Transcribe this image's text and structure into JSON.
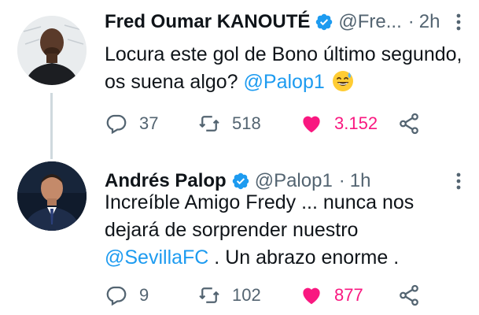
{
  "tweets": [
    {
      "author_name": "Fred Oumar KANOUTÉ",
      "handle": "@Fre...",
      "separator": "·",
      "time": "2h",
      "text_before": "Locura este gol de Bono último segundo, os suena algo? ",
      "mention": "@Palop1",
      "emoji": "grinning-sweat-emoji",
      "replies": "37",
      "retweets": "518",
      "likes": "3.152",
      "liked": true
    },
    {
      "author_name": "Andrés Palop",
      "handle": "@Palop1",
      "separator": "·",
      "time": "1h",
      "text_before": "Increíble Amigo Fredy ... nunca nos dejará de sorprender nuestro ",
      "mention": "@SevillaFC",
      "text_after": " . Un abrazo enorme .",
      "replies": "9",
      "retweets": "102",
      "likes": "877",
      "liked": true
    }
  ],
  "colors": {
    "accent": "#1d9bf0",
    "like": "#f91880",
    "secondary_text": "#536471",
    "verified": "#1d9bf0"
  }
}
